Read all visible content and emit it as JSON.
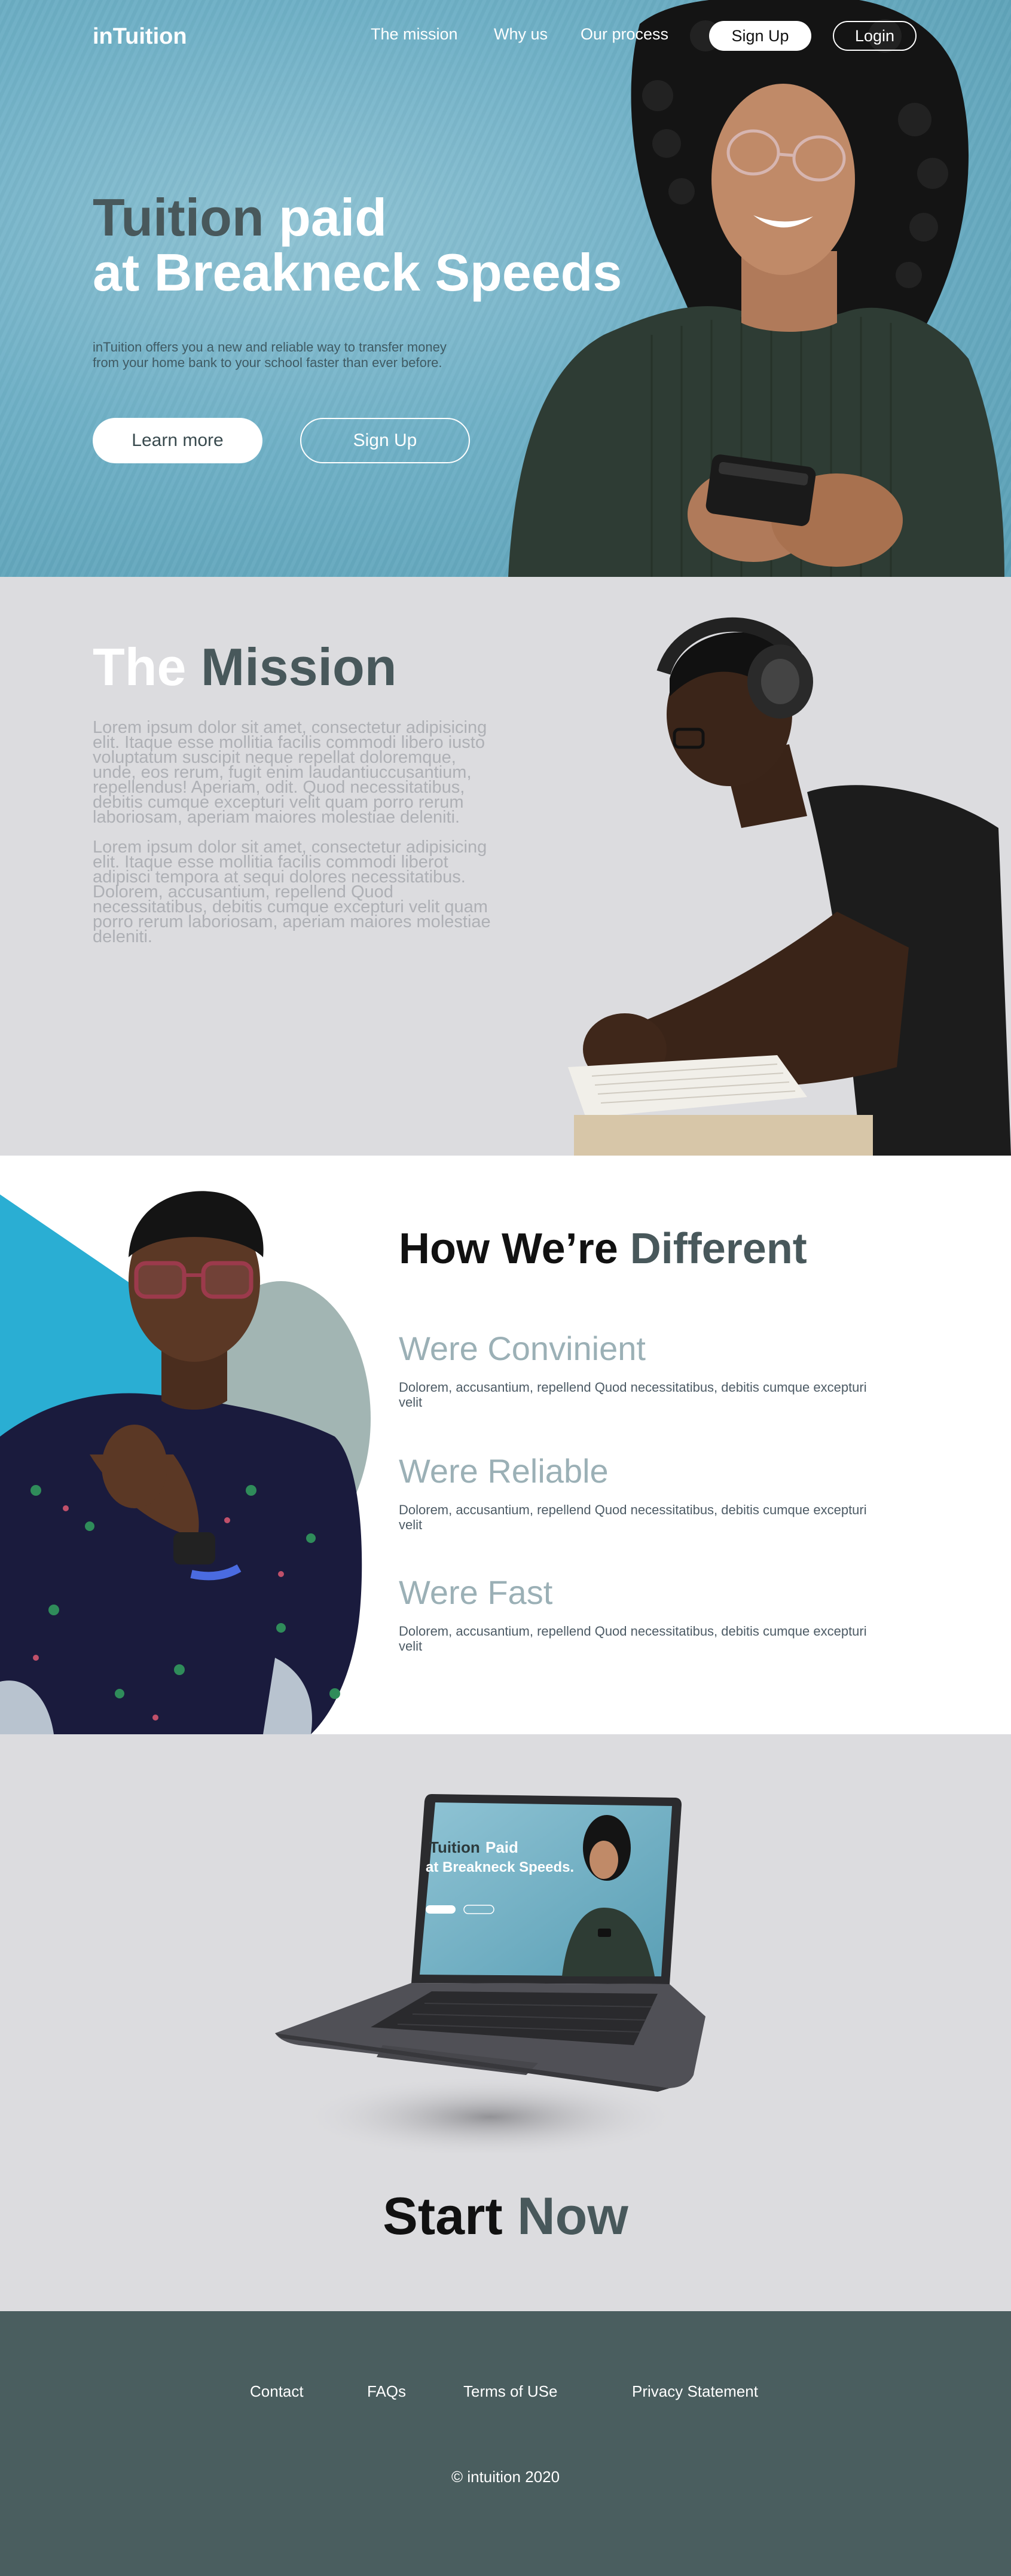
{
  "header": {
    "logo": "inTuition",
    "nav": [
      "The mission",
      "Why us",
      "Our process"
    ],
    "signup_label": "Sign Up",
    "login_label": "Login"
  },
  "hero": {
    "title_line1_dark": "Tuition",
    "title_line1_light": "paid",
    "title_line2": "at Breakneck Speeds",
    "subtitle": "inTuition offers you a new and reliable way to transfer money from your home bank to your school faster than ever before.",
    "learn_more_label": "Learn more",
    "signup_label": "Sign Up"
  },
  "mission": {
    "title_light": "The",
    "title_dark": "Mission",
    "paragraph1": "Lorem ipsum dolor sit amet, consectetur adipisicing elit. Itaque esse mollitia facilis commodi libero iusto voluptatum suscipit neque repellat doloremque, unde, eos rerum, fugit enim laudantiuccusantium, repellendus! Aperiam, odit. Quod necessitatibus, debitis cumque excepturi velit quam porro rerum laboriosam, aperiam maiores molestiae deleniti.",
    "paragraph2": "Lorem ipsum dolor sit amet, consectetur adipisicing elit. Itaque esse mollitia facilis commodi liberot adipisci tempora at sequi dolores necessitatibus. Dolorem, accusantium, repellend Quod necessitatibus, debitis cumque excepturi velit quam porro rerum laboriosam, aperiam maiores molestiae deleniti."
  },
  "different": {
    "title_dark": "How We’re",
    "title_accent": "Different",
    "features": [
      {
        "title": "Were Convinient",
        "text": "Dolorem, accusantium, repellend Quod necessitatibus, debitis cumque excepturi velit"
      },
      {
        "title": "Were Reliable",
        "text": "Dolorem, accusantium, repellend Quod necessitatibus, debitis cumque excepturi velit"
      },
      {
        "title": "Were Fast",
        "text": "Dolorem, accusantium, repellend Quod necessitatibus, debitis cumque excepturi velit"
      }
    ]
  },
  "start": {
    "title_dark": "Start",
    "title_accent": "Now",
    "laptop_screen": {
      "title_light": "Tuition",
      "title_accent": "Paid",
      "title_line2": "at Breakneck Speeds."
    }
  },
  "footer": {
    "links": [
      "Contact",
      "FAQs",
      "Terms of USe",
      "Privacy Statement"
    ],
    "copyright": "© intuition 2020"
  },
  "colors": {
    "hero_blue": "#6fb0c6",
    "slate": "#48585b",
    "light_gray": "#dcdcdf",
    "cyan_accent": "#2aaed3",
    "sage": "#a2b5b3",
    "footer": "#4a5e5f"
  }
}
